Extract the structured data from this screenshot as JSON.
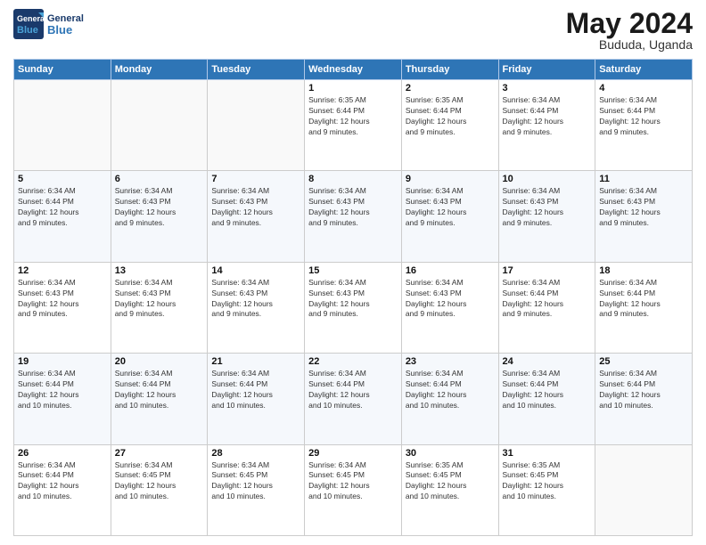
{
  "header": {
    "logo_line1": "General",
    "logo_line2": "Blue",
    "title": "May 2024",
    "location": "Bududa, Uganda"
  },
  "days_of_week": [
    "Sunday",
    "Monday",
    "Tuesday",
    "Wednesday",
    "Thursday",
    "Friday",
    "Saturday"
  ],
  "weeks": [
    [
      {
        "day": "",
        "info": ""
      },
      {
        "day": "",
        "info": ""
      },
      {
        "day": "",
        "info": ""
      },
      {
        "day": "1",
        "info": "Sunrise: 6:35 AM\nSunset: 6:44 PM\nDaylight: 12 hours\nand 9 minutes."
      },
      {
        "day": "2",
        "info": "Sunrise: 6:35 AM\nSunset: 6:44 PM\nDaylight: 12 hours\nand 9 minutes."
      },
      {
        "day": "3",
        "info": "Sunrise: 6:34 AM\nSunset: 6:44 PM\nDaylight: 12 hours\nand 9 minutes."
      },
      {
        "day": "4",
        "info": "Sunrise: 6:34 AM\nSunset: 6:44 PM\nDaylight: 12 hours\nand 9 minutes."
      }
    ],
    [
      {
        "day": "5",
        "info": "Sunrise: 6:34 AM\nSunset: 6:44 PM\nDaylight: 12 hours\nand 9 minutes."
      },
      {
        "day": "6",
        "info": "Sunrise: 6:34 AM\nSunset: 6:43 PM\nDaylight: 12 hours\nand 9 minutes."
      },
      {
        "day": "7",
        "info": "Sunrise: 6:34 AM\nSunset: 6:43 PM\nDaylight: 12 hours\nand 9 minutes."
      },
      {
        "day": "8",
        "info": "Sunrise: 6:34 AM\nSunset: 6:43 PM\nDaylight: 12 hours\nand 9 minutes."
      },
      {
        "day": "9",
        "info": "Sunrise: 6:34 AM\nSunset: 6:43 PM\nDaylight: 12 hours\nand 9 minutes."
      },
      {
        "day": "10",
        "info": "Sunrise: 6:34 AM\nSunset: 6:43 PM\nDaylight: 12 hours\nand 9 minutes."
      },
      {
        "day": "11",
        "info": "Sunrise: 6:34 AM\nSunset: 6:43 PM\nDaylight: 12 hours\nand 9 minutes."
      }
    ],
    [
      {
        "day": "12",
        "info": "Sunrise: 6:34 AM\nSunset: 6:43 PM\nDaylight: 12 hours\nand 9 minutes."
      },
      {
        "day": "13",
        "info": "Sunrise: 6:34 AM\nSunset: 6:43 PM\nDaylight: 12 hours\nand 9 minutes."
      },
      {
        "day": "14",
        "info": "Sunrise: 6:34 AM\nSunset: 6:43 PM\nDaylight: 12 hours\nand 9 minutes."
      },
      {
        "day": "15",
        "info": "Sunrise: 6:34 AM\nSunset: 6:43 PM\nDaylight: 12 hours\nand 9 minutes."
      },
      {
        "day": "16",
        "info": "Sunrise: 6:34 AM\nSunset: 6:43 PM\nDaylight: 12 hours\nand 9 minutes."
      },
      {
        "day": "17",
        "info": "Sunrise: 6:34 AM\nSunset: 6:44 PM\nDaylight: 12 hours\nand 9 minutes."
      },
      {
        "day": "18",
        "info": "Sunrise: 6:34 AM\nSunset: 6:44 PM\nDaylight: 12 hours\nand 9 minutes."
      }
    ],
    [
      {
        "day": "19",
        "info": "Sunrise: 6:34 AM\nSunset: 6:44 PM\nDaylight: 12 hours\nand 10 minutes."
      },
      {
        "day": "20",
        "info": "Sunrise: 6:34 AM\nSunset: 6:44 PM\nDaylight: 12 hours\nand 10 minutes."
      },
      {
        "day": "21",
        "info": "Sunrise: 6:34 AM\nSunset: 6:44 PM\nDaylight: 12 hours\nand 10 minutes."
      },
      {
        "day": "22",
        "info": "Sunrise: 6:34 AM\nSunset: 6:44 PM\nDaylight: 12 hours\nand 10 minutes."
      },
      {
        "day": "23",
        "info": "Sunrise: 6:34 AM\nSunset: 6:44 PM\nDaylight: 12 hours\nand 10 minutes."
      },
      {
        "day": "24",
        "info": "Sunrise: 6:34 AM\nSunset: 6:44 PM\nDaylight: 12 hours\nand 10 minutes."
      },
      {
        "day": "25",
        "info": "Sunrise: 6:34 AM\nSunset: 6:44 PM\nDaylight: 12 hours\nand 10 minutes."
      }
    ],
    [
      {
        "day": "26",
        "info": "Sunrise: 6:34 AM\nSunset: 6:44 PM\nDaylight: 12 hours\nand 10 minutes."
      },
      {
        "day": "27",
        "info": "Sunrise: 6:34 AM\nSunset: 6:45 PM\nDaylight: 12 hours\nand 10 minutes."
      },
      {
        "day": "28",
        "info": "Sunrise: 6:34 AM\nSunset: 6:45 PM\nDaylight: 12 hours\nand 10 minutes."
      },
      {
        "day": "29",
        "info": "Sunrise: 6:34 AM\nSunset: 6:45 PM\nDaylight: 12 hours\nand 10 minutes."
      },
      {
        "day": "30",
        "info": "Sunrise: 6:35 AM\nSunset: 6:45 PM\nDaylight: 12 hours\nand 10 minutes."
      },
      {
        "day": "31",
        "info": "Sunrise: 6:35 AM\nSunset: 6:45 PM\nDaylight: 12 hours\nand 10 minutes."
      },
      {
        "day": "",
        "info": ""
      }
    ]
  ]
}
